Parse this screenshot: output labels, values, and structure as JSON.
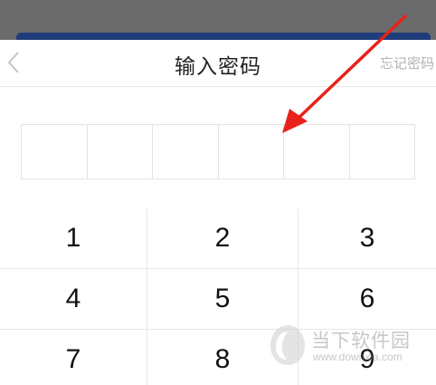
{
  "header": {
    "title": "输入密码",
    "forgot_label": "忘记密码"
  },
  "pin": {
    "length": 6,
    "filled": 0
  },
  "keypad": {
    "keys": [
      "1",
      "2",
      "3",
      "4",
      "5",
      "6",
      "7",
      "8",
      "9"
    ]
  },
  "watermark": {
    "name": "当下软件园",
    "url": "www.downxia.com"
  },
  "colors": {
    "backdrop": "#6b6b6b",
    "accent_bar": "#1f3d7a",
    "arrow": "#e8221b",
    "forgot_text": "#b3b3b3",
    "divider": "#e6e6e6"
  },
  "icons": {
    "back": "chevron-left-icon",
    "annotation": "red-arrow-icon",
    "watermark_logo": "downxia-logo-icon"
  }
}
